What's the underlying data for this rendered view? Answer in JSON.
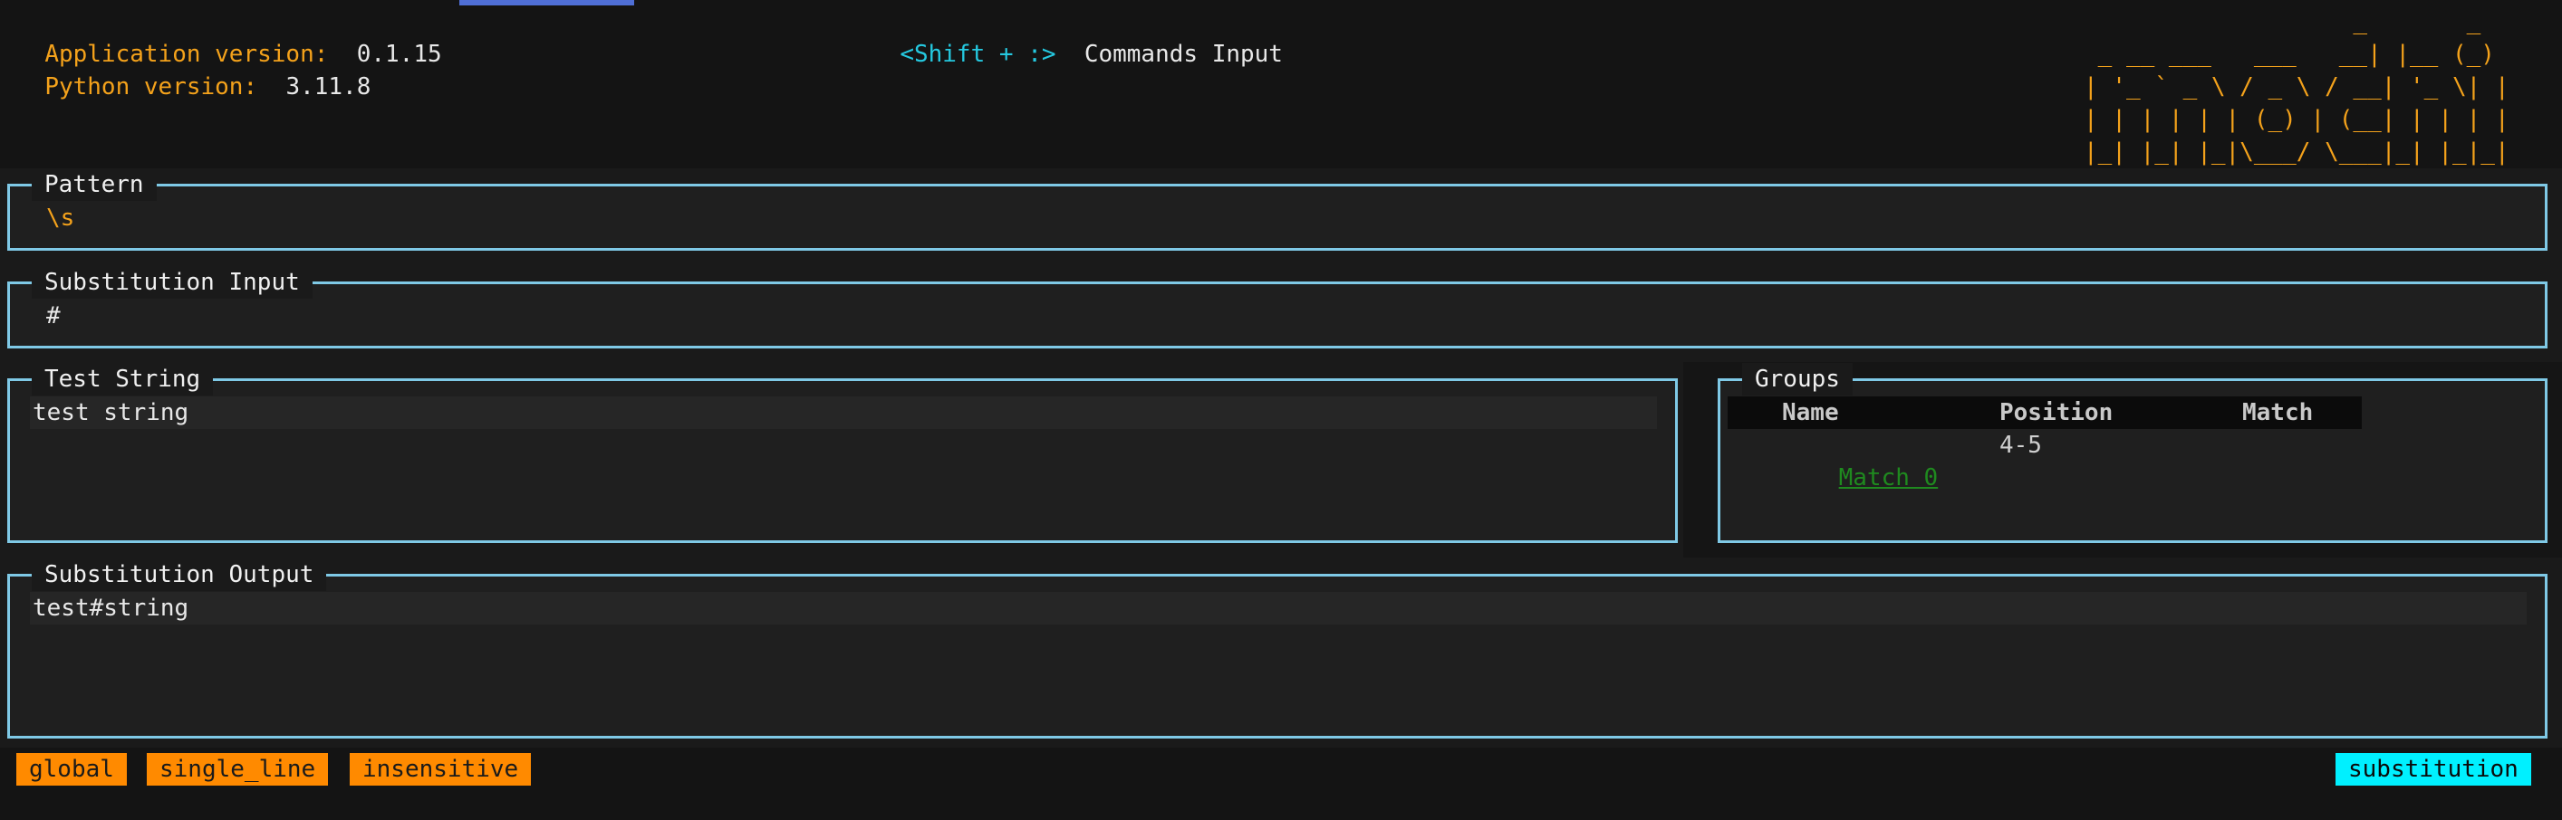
{
  "header": {
    "app_version_label": "Application version:",
    "app_version_value": "0.1.15",
    "python_version_label": "Python version:",
    "python_version_value": "3.11.8",
    "shortcut": "<Shift + :>",
    "commands_label": "Commands Input",
    "logo_ascii": "                   _       _\n _ __ ___   ___   __| |__ (_)\n| '_ ` _ \\ / _ \\ / __| '_ \\| |\n| | | | | | (_) | (__| | | | |\n|_| |_| |_|\\___/ \\___|_| |_|_|"
  },
  "pattern": {
    "title": "Pattern",
    "value": "\\s"
  },
  "substitution_input": {
    "title": "Substitution Input",
    "value": "#"
  },
  "test_string": {
    "title": "Test String",
    "value": "test string"
  },
  "groups": {
    "title": "Groups",
    "columns": [
      "Name",
      "Position",
      "Match"
    ],
    "rows": [
      {
        "name": "Match 0",
        "position": "4-5",
        "match": ""
      }
    ]
  },
  "substitution_output": {
    "title": "Substitution Output",
    "value": "test#string"
  },
  "footer": {
    "flags": [
      "global",
      "single_line",
      "insensitive"
    ],
    "mode": "substitution"
  },
  "colors": {
    "accent_orange": "#f4a21b",
    "accent_cyan": "#25c9e0",
    "panel_border": "#7fc9e6",
    "flag_bg": "#ff8a00",
    "mode_bg": "#00f0ff",
    "match_green": "#1f8a1f"
  }
}
